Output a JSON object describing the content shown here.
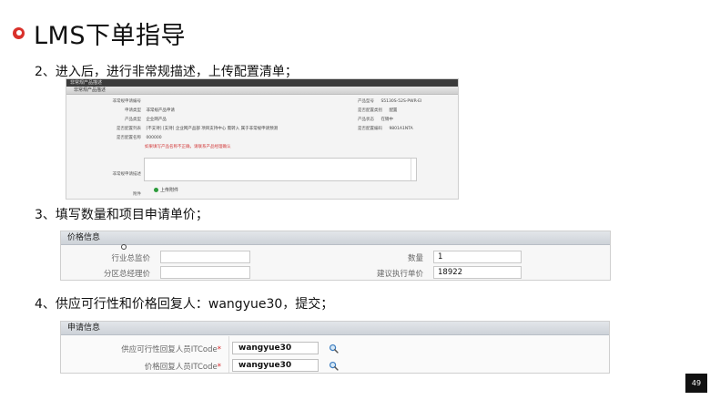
{
  "title": "LMS下单指导",
  "steps": {
    "step2": "2、进入后，进行非常规描述，上传配置清单；",
    "step3": "3、填写数量和项目申请单价；",
    "step4": "4、供应可行性和价格回复人：wangyue30，提交；"
  },
  "shot1": {
    "topbar": "非常规产品描述",
    "subbar": "非常规产品描述",
    "rows": [
      {
        "label": "非常规申请编号",
        "value": "",
        "rlabel": "产品型号",
        "rvalue": "S5130S-52S-PWR-EI"
      },
      {
        "label": "申请类型",
        "value": "非常规产品申请",
        "rlabel": "是否配置类别",
        "rvalue": "配置"
      },
      {
        "label": "产品类型",
        "value": "企业网产品",
        "rlabel": "产品状态",
        "rvalue": "在销中"
      },
      {
        "label": "是否配置列表",
        "value": "[不支持] [支持] 企业网产品部 项目支持中心 需转入 属于非常规申请预测",
        "rlabel": "是否配置编码",
        "rvalue": "9801A1NTA"
      },
      {
        "label": "是否配置名称",
        "value": "000000",
        "rlabel": "",
        "rvalue": ""
      }
    ],
    "red_note": "如果填写产品名称不正确，请联系产品经理确认",
    "desc_label": "非常规申请描述",
    "attach_label": "附件",
    "upload_label": "上传附件"
  },
  "price_panel": {
    "header": "价格信息",
    "industry_price_label": "行业总监价",
    "industry_price_value": "",
    "quantity_label": "数量",
    "quantity_value": "1",
    "region_price_label": "分区总经理价",
    "region_price_value": "",
    "suggest_price_label": "建议执行单价",
    "suggest_price_value": "18922"
  },
  "apply_panel": {
    "header": "申请信息",
    "supply_label": "供应可行性回复人员ITCode",
    "supply_value": "wangyue30",
    "price_label": "价格回复人员ITCode",
    "price_value": "wangyue30",
    "required_mark": "*"
  },
  "page_number": "49",
  "colors": {
    "accent_red": "#d9312b",
    "required_red": "#d8282b",
    "panel_header": "#cdd2d8"
  }
}
